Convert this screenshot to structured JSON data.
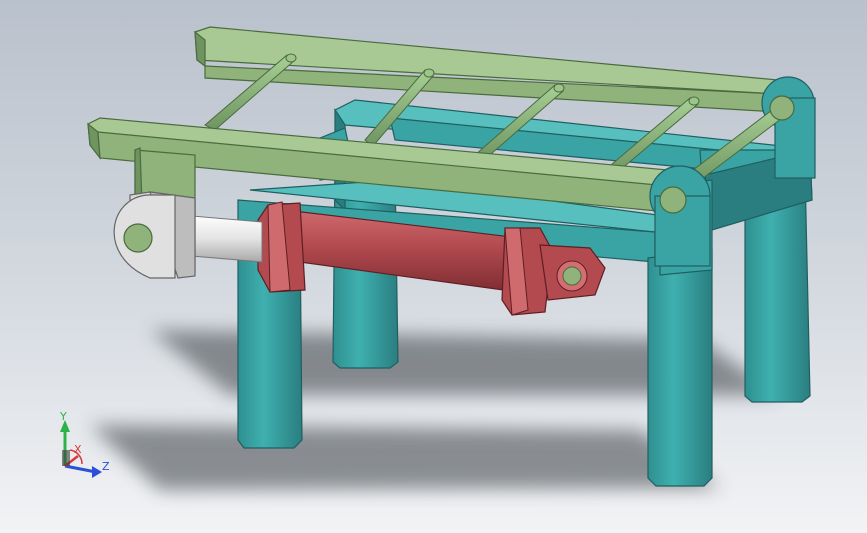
{
  "triad": {
    "y_label": "Y",
    "z_label": "Z",
    "x_label": "X",
    "colors": {
      "y": "#2bb34a",
      "z": "#2b4fd6",
      "x": "#d63a3a"
    }
  },
  "parts": {
    "frame": {
      "color": "#3aa3a3",
      "dark": "#2a7e80",
      "light": "#57c0bf"
    },
    "forks": {
      "color": "#8fb37a",
      "dark": "#6f9460",
      "light": "#a9c994"
    },
    "rollers": {
      "color": "#7aa36a",
      "light": "#9cc48b"
    },
    "cylinder": {
      "color": "#b24a4f",
      "dark": "#8a3338",
      "light": "#cf6a6e"
    },
    "rod": {
      "color": "#e6e6e6",
      "dark": "#b9b9b9"
    },
    "clevis": {
      "color": "#d9d9d9",
      "dark": "#a9a9a9"
    }
  }
}
